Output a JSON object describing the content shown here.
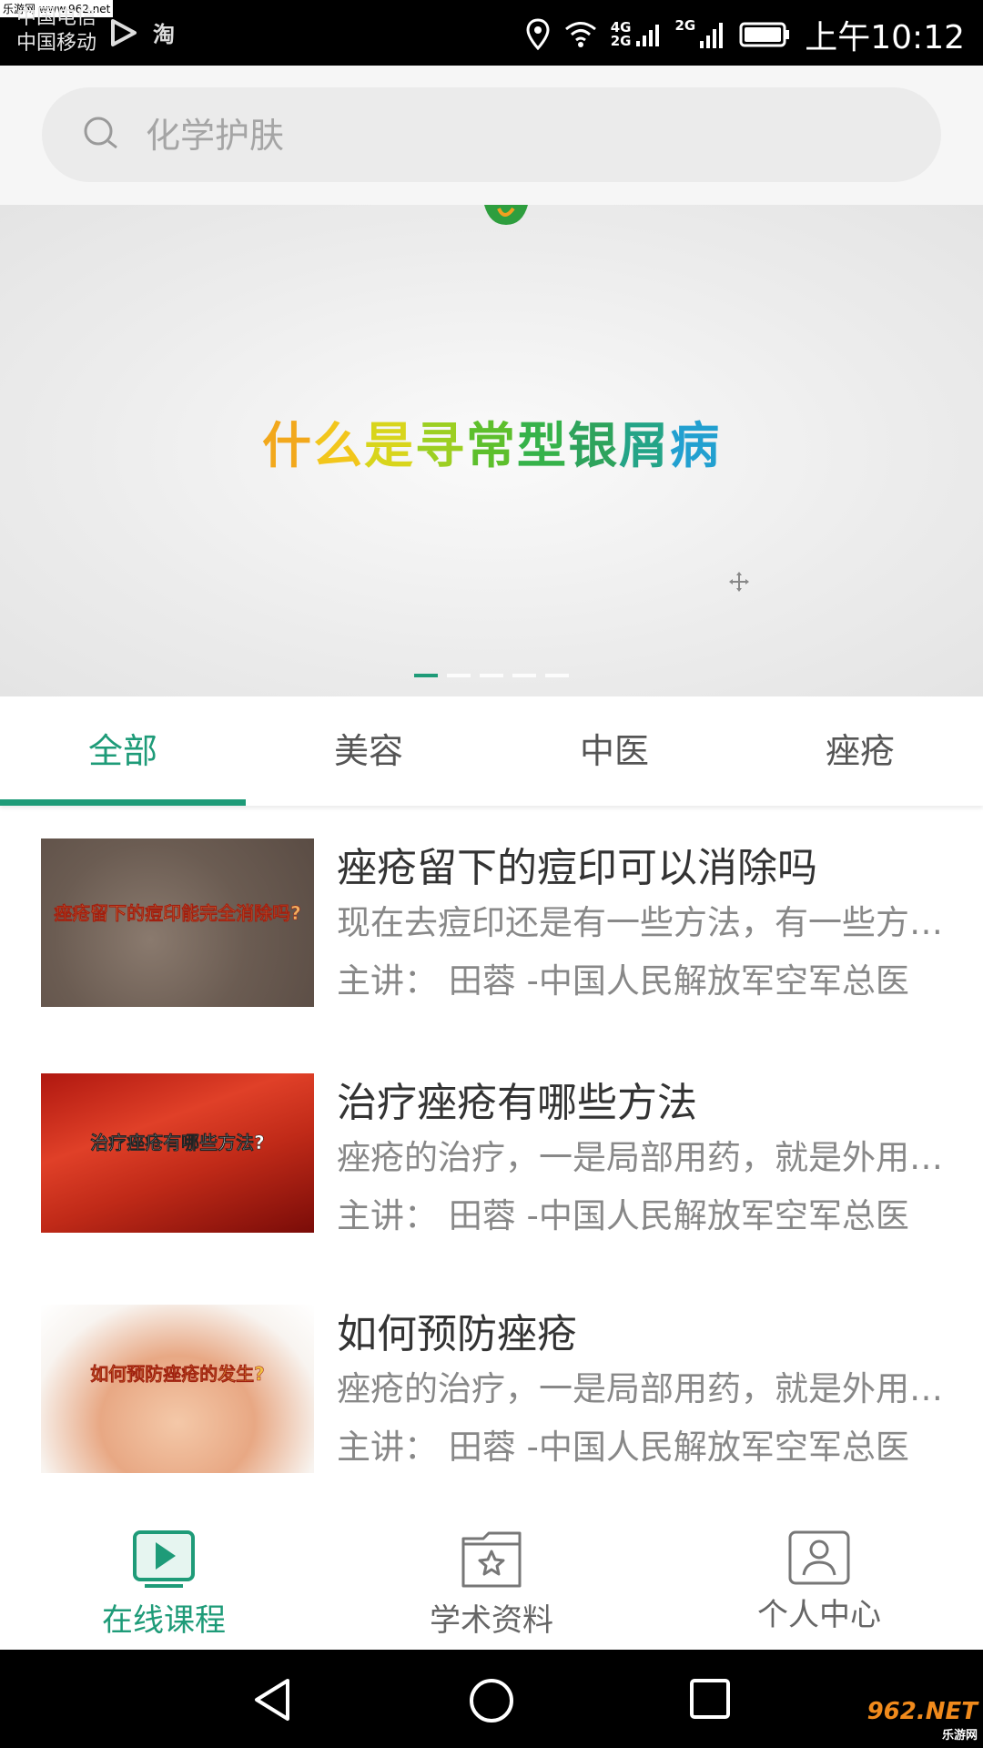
{
  "status_bar": {
    "watermark": "乐游网 www.962.net",
    "carrier_1": "中国电信",
    "carrier_2": "中国移动",
    "net_4g": "4G",
    "net_2g_a": "2G",
    "net_2g_b": "2G",
    "app_icon_label": "淘",
    "time": "上午10:12"
  },
  "search": {
    "placeholder": "化学护肤"
  },
  "banner": {
    "title_chars": [
      "什",
      "么",
      "是",
      "寻",
      "常",
      "型",
      "银",
      "屑",
      "病"
    ],
    "title_colors": [
      "#f2a81c",
      "#f2c61c",
      "#d8d51c",
      "#9ccf22",
      "#5dbf2c",
      "#36b24a",
      "#2ea35c",
      "#24a487",
      "#22a0d0"
    ],
    "dot_count": 5,
    "active_dot": 0
  },
  "tabs": [
    {
      "label": "全部",
      "active": true
    },
    {
      "label": "美容",
      "active": false
    },
    {
      "label": "中医",
      "active": false
    },
    {
      "label": "痤疮",
      "active": false
    }
  ],
  "courses": [
    {
      "title": "痤疮留下的痘印可以消除吗",
      "desc": "现在去痘印还是有一些方法，有一些方法可以改善",
      "speaker": "主讲：  田蓉 -中国人民解放军空军总医",
      "thumb_text": "痤疮留下的痘印能完全消除吗?"
    },
    {
      "title": "治疗痤疮有哪些方法",
      "desc": "痤疮的治疗，一是局部用药，就是外用药物",
      "speaker": "主讲：  田蓉 -中国人民解放军空军总医",
      "thumb_text": "治疗痤疮有哪些方法?"
    },
    {
      "title": "如何预防痤疮",
      "desc": "痤疮的治疗，一是局部用药，就是外用药物",
      "speaker": "主讲：  田蓉 -中国人民解放军空军总医",
      "thumb_text": "如何预防痤疮的发生?"
    }
  ],
  "bottom_nav": [
    {
      "label": "在线课程",
      "icon": "play-icon",
      "active": true
    },
    {
      "label": "学术资料",
      "icon": "folder-star-icon",
      "active": false
    },
    {
      "label": "个人中心",
      "icon": "person-icon",
      "active": false
    }
  ],
  "system_nav": {
    "logo_main": "962.NET",
    "logo_sub": "乐游网"
  },
  "colors": {
    "accent": "#1e9b78",
    "text_primary": "#333333",
    "text_secondary": "#888888"
  }
}
